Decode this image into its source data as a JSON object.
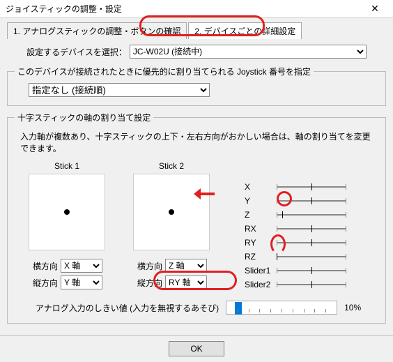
{
  "window": {
    "title": "ジョイスティックの調整・設定",
    "close": "✕"
  },
  "tabs": {
    "t1": "1. アナログスティックの調整・ボタンの確認",
    "t2": "2. デバイスごとの詳細設定"
  },
  "device": {
    "label": "設定するデバイスを選択：",
    "selected": "JC-W02U (接続中)"
  },
  "priority_group": {
    "legend": "このデバイスが接続されたときに優先的に割り当てられる Joystick 番号を指定",
    "selected": "指定なし (接続順)"
  },
  "cross_group": {
    "legend": "十字スティックの軸の割り当て設定",
    "desc": "入力軸が複数あり、十字スティックの上下・左右方向がおかしい場合は、軸の割り当てを変更できます。"
  },
  "stick1": {
    "label": "Stick 1",
    "h_label": "横方向",
    "h_value": "X 軸",
    "v_label": "縦方向",
    "v_value": "Y 軸"
  },
  "stick2": {
    "label": "Stick 2",
    "h_label": "横方向",
    "h_value": "Z 軸",
    "v_label": "縦方向",
    "v_value": "RY 軸"
  },
  "axes": {
    "x": "X",
    "y": "Y",
    "z": "Z",
    "rx": "RX",
    "ry": "RY",
    "rz": "RZ",
    "s1": "Slider1",
    "s2": "Slider2"
  },
  "threshold": {
    "label": "アナログ入力のしきい値 (入力を無視するあそび)",
    "value": "10%"
  },
  "buttons": {
    "ok": "OK"
  }
}
